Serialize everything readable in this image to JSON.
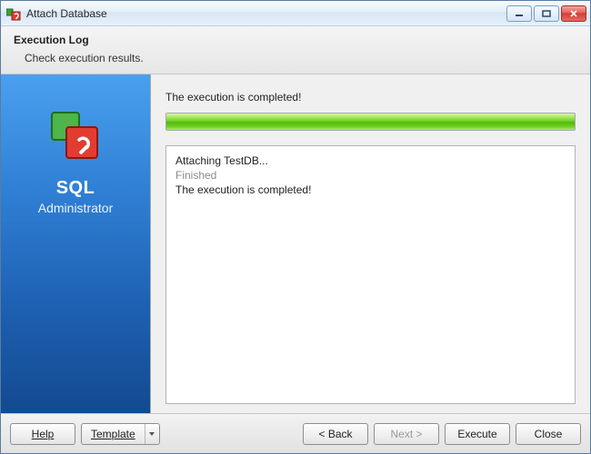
{
  "window": {
    "title": "Attach Database"
  },
  "header": {
    "title": "Execution Log",
    "subtitle": "Check execution results."
  },
  "sidebar": {
    "product_title": "SQL",
    "product_subtitle": "Administrator"
  },
  "main": {
    "status": "The execution is completed!",
    "progress_percent": 100,
    "log": [
      {
        "text": "Attaching TestDB...",
        "kind": "normal"
      },
      {
        "text": "Finished",
        "kind": "finished"
      },
      {
        "text": "The execution is completed!",
        "kind": "normal"
      }
    ]
  },
  "buttons": {
    "help": "Help",
    "template": "Template",
    "back": "< Back",
    "next": "Next >",
    "execute": "Execute",
    "close": "Close"
  },
  "colors": {
    "progress_green": "#54b80a",
    "sidebar_blue_top": "#4aa0ef",
    "sidebar_blue_bottom": "#134a90",
    "close_red": "#d13c34"
  }
}
